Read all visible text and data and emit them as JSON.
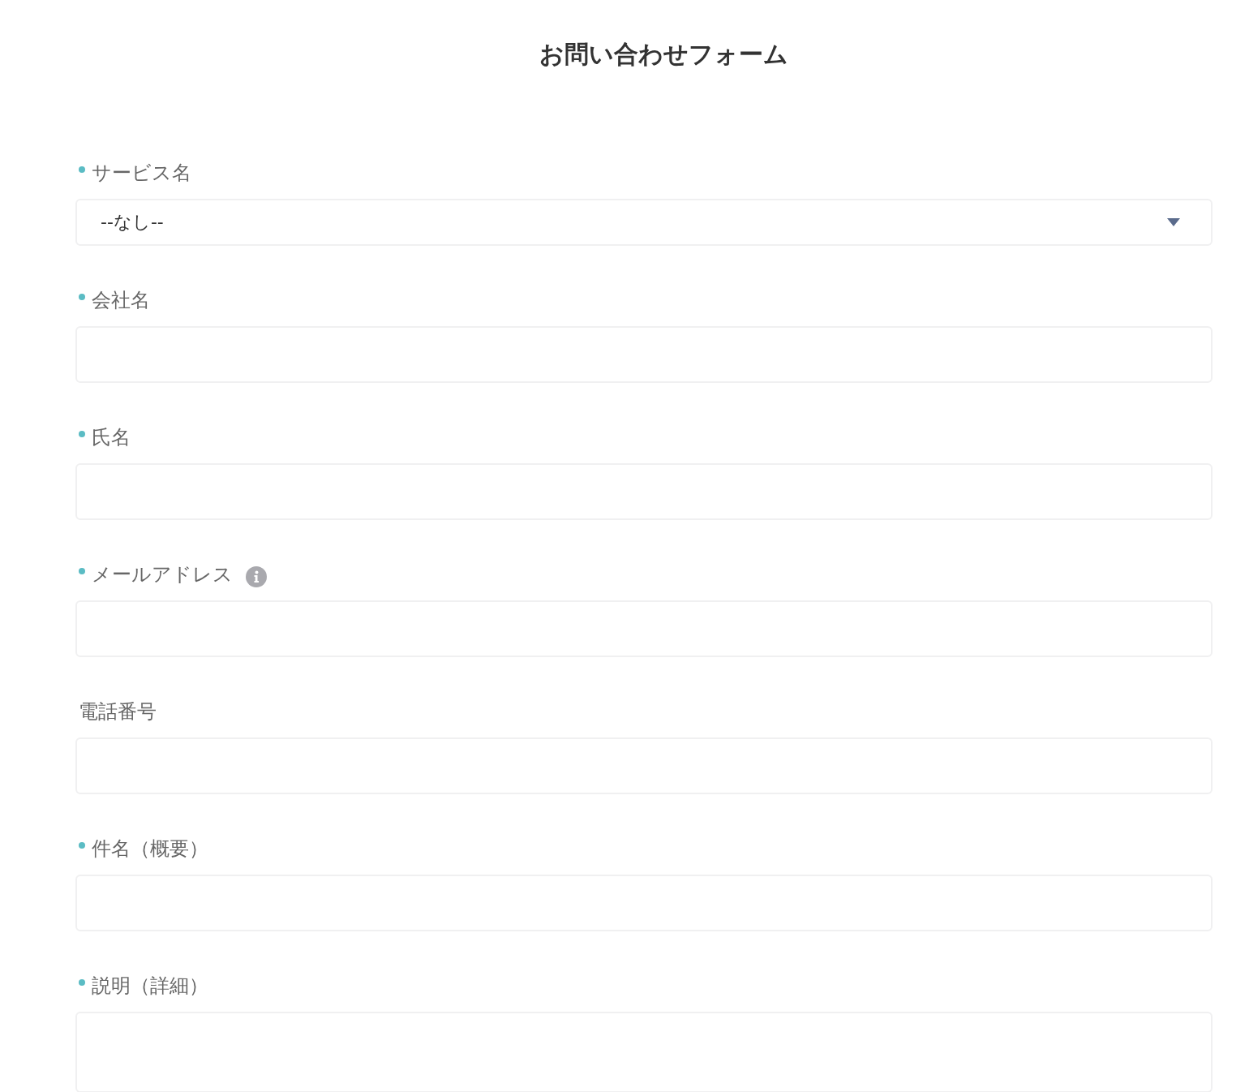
{
  "title": "お問い合わせフォーム",
  "fields": [
    {
      "label": "サービス名",
      "required": true,
      "info": false,
      "kind": "select",
      "value": "--なし--"
    },
    {
      "label": "会社名",
      "required": true,
      "info": false,
      "kind": "text"
    },
    {
      "label": "氏名",
      "required": true,
      "info": false,
      "kind": "text"
    },
    {
      "label": "メールアドレス",
      "required": true,
      "info": true,
      "kind": "text"
    },
    {
      "label": "電話番号",
      "required": false,
      "info": false,
      "kind": "text"
    },
    {
      "label": "件名（概要）",
      "required": true,
      "info": false,
      "kind": "text"
    },
    {
      "label": "説明（詳細）",
      "required": true,
      "info": false,
      "kind": "textarea"
    }
  ]
}
